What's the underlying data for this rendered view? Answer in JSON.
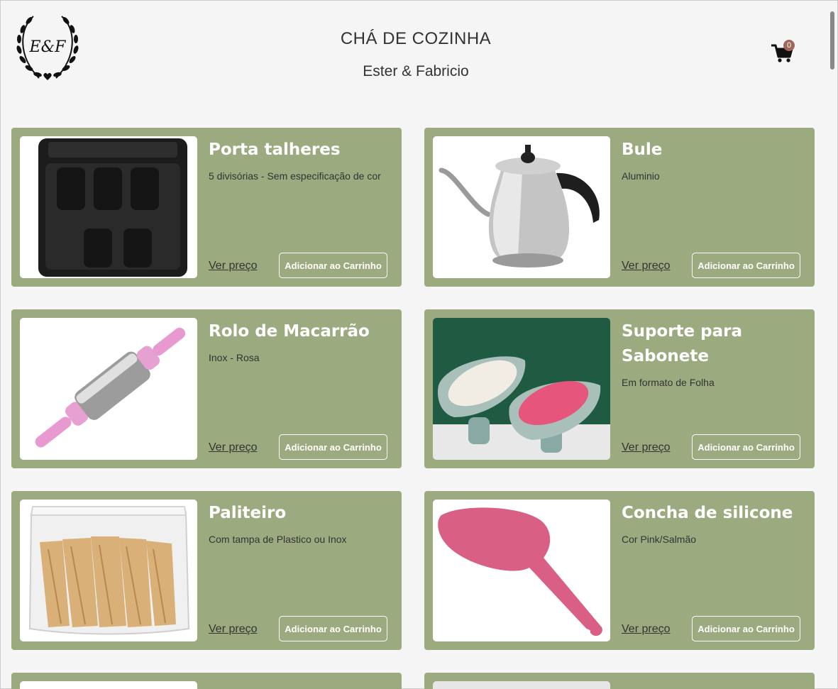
{
  "header": {
    "title": "CHÁ DE COZINHA",
    "subtitle": "Ester & Fabricio",
    "logo_text": "E&F",
    "cart_count": "0"
  },
  "colors": {
    "card_bg": "#9cab7f",
    "badge": "#a0665a",
    "page_bg": "#f5f5f5"
  },
  "products": [
    {
      "name": "Porta talheres",
      "desc": "5 divisórias - Sem especificação de cor",
      "price_label": "Ver preço",
      "add_label": "Adicionar ao Carrinho",
      "icon": "cutlery-tray"
    },
    {
      "name": "Bule",
      "desc": "Aluminio",
      "price_label": "Ver preço",
      "add_label": "Adicionar ao Carrinho",
      "icon": "kettle"
    },
    {
      "name": "Rolo de Macarrão",
      "desc": "Inox - Rosa",
      "price_label": "Ver preço",
      "add_label": "Adicionar ao Carrinho",
      "icon": "rolling-pin"
    },
    {
      "name": "Suporte para Sabonete",
      "desc": "Em formato de Folha",
      "price_label": "Ver preço",
      "add_label": "Adicionar ao Carrinho",
      "icon": "soap-holder"
    },
    {
      "name": "Paliteiro",
      "desc": "Com tampa de Plastico ou Inox",
      "price_label": "Ver preço",
      "add_label": "Adicionar ao Carrinho",
      "icon": "toothpick-holder"
    },
    {
      "name": "Concha de silicone",
      "desc": "Cor Pink/Salmão",
      "price_label": "Ver preço",
      "add_label": "Adicionar ao Carrinho",
      "icon": "silicone-ladle"
    }
  ]
}
